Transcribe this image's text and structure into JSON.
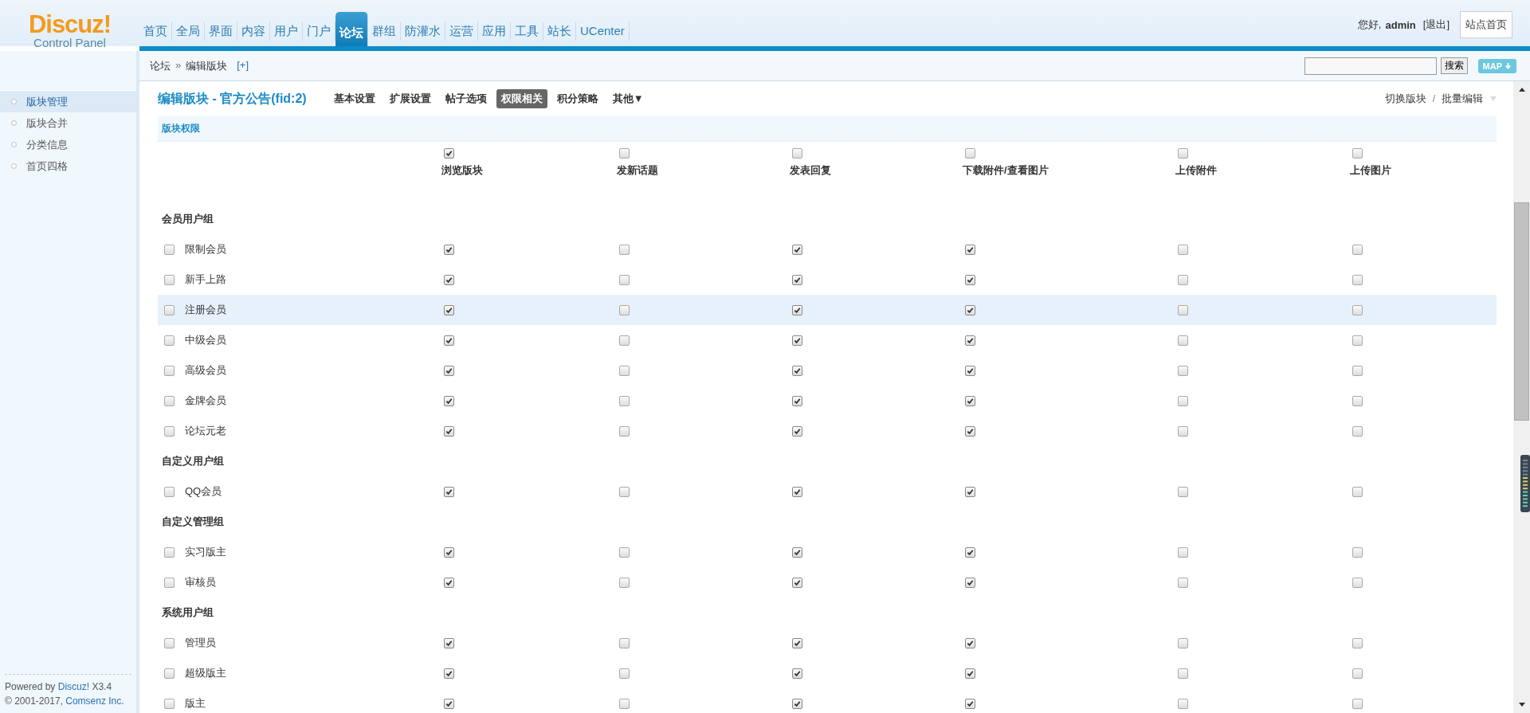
{
  "header": {
    "logo": {
      "title": "Discuz!",
      "subtitle": "Control Panel"
    },
    "nav": [
      {
        "label": "首页",
        "selected": false
      },
      {
        "label": "全局",
        "selected": false
      },
      {
        "label": "界面",
        "selected": false
      },
      {
        "label": "内容",
        "selected": false
      },
      {
        "label": "用户",
        "selected": false
      },
      {
        "label": "门户",
        "selected": false
      },
      {
        "label": "论坛",
        "selected": true
      },
      {
        "label": "群组",
        "selected": false
      },
      {
        "label": "防灌水",
        "selected": false
      },
      {
        "label": "运营",
        "selected": false
      },
      {
        "label": "应用",
        "selected": false
      },
      {
        "label": "工具",
        "selected": false
      },
      {
        "label": "站长",
        "selected": false
      },
      {
        "label": "UCenter",
        "selected": false
      }
    ],
    "greeting": "您好,",
    "user": "admin",
    "logout": "[退出]",
    "home_button": "站点首页"
  },
  "breadcrumb": {
    "items": [
      "论坛",
      "编辑版块"
    ],
    "separator": "»",
    "add": "[+]"
  },
  "search": {
    "button": "搜索"
  },
  "map_button": "MAP",
  "sidebar": {
    "items": [
      {
        "label": "版块管理",
        "selected": true
      },
      {
        "label": "版块合并",
        "selected": false
      },
      {
        "label": "分类信息",
        "selected": false
      },
      {
        "label": "首页四格",
        "selected": false
      }
    ],
    "footer": {
      "powered": "Powered by",
      "product": "Discuz!",
      "version": "X3.4",
      "copyright": "© 2001-2017,",
      "company": "Comsenz Inc."
    }
  },
  "page": {
    "title": "编辑版块 - 官方公告(fid:2)",
    "tabs": [
      {
        "label": "基本设置",
        "selected": false
      },
      {
        "label": "扩展设置",
        "selected": false
      },
      {
        "label": "帖子选项",
        "selected": false
      },
      {
        "label": "权限相关",
        "selected": true
      },
      {
        "label": "积分策略",
        "selected": false
      },
      {
        "label": "其他▼",
        "selected": false
      }
    ],
    "links": [
      "切换版块",
      "/",
      "批量编辑"
    ],
    "section": "版块权限",
    "columns": [
      {
        "label": "浏览版块",
        "checked": true
      },
      {
        "label": "发新话题",
        "checked": false
      },
      {
        "label": "发表回复",
        "checked": false
      },
      {
        "label": "下载附件/查看图片",
        "checked": false
      },
      {
        "label": "上传附件",
        "checked": false
      },
      {
        "label": "上传图片",
        "checked": false
      }
    ],
    "groups": [
      {
        "title": "会员用户组",
        "rows": [
          {
            "name": "限制会员",
            "checked": false,
            "highlighted": false,
            "perms": [
              true,
              false,
              true,
              true,
              false,
              false
            ]
          },
          {
            "name": "新手上路",
            "checked": false,
            "highlighted": false,
            "perms": [
              true,
              false,
              true,
              true,
              false,
              false
            ]
          },
          {
            "name": "注册会员",
            "checked": false,
            "highlighted": true,
            "perms": [
              true,
              false,
              true,
              true,
              false,
              false
            ]
          },
          {
            "name": "中级会员",
            "checked": false,
            "highlighted": false,
            "perms": [
              true,
              false,
              true,
              true,
              false,
              false
            ]
          },
          {
            "name": "高级会员",
            "checked": false,
            "highlighted": false,
            "perms": [
              true,
              false,
              true,
              true,
              false,
              false
            ]
          },
          {
            "name": "金牌会员",
            "checked": false,
            "highlighted": false,
            "perms": [
              true,
              false,
              true,
              true,
              false,
              false
            ]
          },
          {
            "name": "论坛元老",
            "checked": false,
            "highlighted": false,
            "perms": [
              true,
              false,
              true,
              true,
              false,
              false
            ]
          }
        ]
      },
      {
        "title": "自定义用户组",
        "rows": [
          {
            "name": "QQ会员",
            "checked": false,
            "highlighted": false,
            "perms": [
              true,
              false,
              true,
              true,
              false,
              false
            ]
          }
        ]
      },
      {
        "title": "自定义管理组",
        "rows": [
          {
            "name": "实习版主",
            "checked": false,
            "highlighted": false,
            "perms": [
              true,
              false,
              true,
              true,
              false,
              false
            ]
          },
          {
            "name": "审核员",
            "checked": false,
            "highlighted": false,
            "perms": [
              true,
              false,
              true,
              true,
              false,
              false
            ]
          }
        ]
      },
      {
        "title": "系统用户组",
        "rows": [
          {
            "name": "管理员",
            "checked": false,
            "highlighted": false,
            "perms": [
              true,
              false,
              true,
              true,
              false,
              false
            ]
          },
          {
            "name": "超级版主",
            "checked": false,
            "highlighted": false,
            "perms": [
              true,
              false,
              true,
              true,
              false,
              false
            ]
          },
          {
            "name": "版主",
            "checked": false,
            "highlighted": false,
            "perms": [
              true,
              false,
              true,
              true,
              false,
              false
            ]
          }
        ]
      }
    ]
  }
}
